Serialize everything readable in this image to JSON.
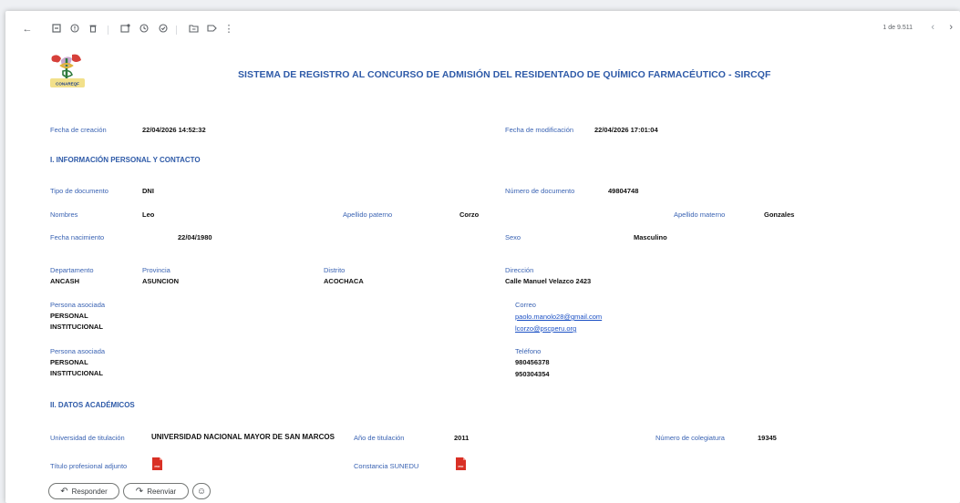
{
  "toolbar": {
    "icons": [
      "back-arrow-icon",
      "archive-icon",
      "report-spam-icon",
      "delete-icon",
      "mark-unread-icon",
      "snooze-icon",
      "add-task-icon",
      "move-to-icon",
      "label-icon",
      "more-icon"
    ],
    "pager_text": "1 de 9.511"
  },
  "email": {
    "title": "SISTEMA DE REGISTRO AL CONCURSO DE ADMISIÓN DEL RESIDENTADO DE QUÍMICO FARMACÉUTICO - SIRCQF",
    "logo_text": "CONAREQF",
    "fecha_creacion": {
      "label": "Fecha de creación",
      "value": "22/04/2026 14:52:32"
    },
    "fecha_modificacion": {
      "label": "Fecha de modificación",
      "value": "22/04/2026 17:01:04"
    },
    "section1": "I. INFORMACIÓN PERSONAL Y CONTACTO",
    "tipo_documento": {
      "label": "Tipo de documento",
      "value": "DNI"
    },
    "numero_documento": {
      "label": "Número de documento",
      "value": "49804748"
    },
    "nombres": {
      "label": "Nombres",
      "value": "Leo"
    },
    "apellido_paterno": {
      "label": "Apellido paterno",
      "value": "Corzo"
    },
    "apellido_materno": {
      "label": "Apellido materno",
      "value": "Gonzales"
    },
    "fecha_nacimiento": {
      "label": "Fecha nacimiento",
      "value": "22/04/1980"
    },
    "sexo": {
      "label": "Sexo",
      "value": "Masculino"
    },
    "departamento": {
      "label": "Departamento",
      "value": "ANCASH"
    },
    "provincia": {
      "label": "Provincia",
      "value": "ASUNCION"
    },
    "distrito": {
      "label": "Distrito",
      "value": "ACOCHACA"
    },
    "direccion": {
      "label": "Dirección",
      "value": "Calle Manuel Velazco 2423"
    },
    "persona_asociada_1": {
      "label": "Persona asociada",
      "line1": "PERSONAL",
      "line2": "INSTITUCIONAL"
    },
    "correo": {
      "label": "Correo",
      "email1": "paolo.manolo28@gmail.com",
      "email2": "lcorzo@pscperu.org"
    },
    "persona_asociada_2": {
      "label": "Persona asociada",
      "line1": "PERSONAL",
      "line2": "INSTITUCIONAL"
    },
    "telefono": {
      "label": "Teléfono",
      "phone1": "980456378",
      "phone2": "950304354"
    },
    "section2": "II. DATOS ACADÉMICOS",
    "universidad": {
      "label": "Universidad de titulación",
      "value": "UNIVERSIDAD NACIONAL MAYOR DE SAN MARCOS"
    },
    "anio_titulacion": {
      "label": "Año de titulación",
      "value": "2011"
    },
    "colegiatura": {
      "label": "Número de colegiatura",
      "value": "19345"
    },
    "titulo_adjunto": {
      "label": "Título profesional adjunto"
    },
    "constancia": {
      "label": "Constancia SUNEDU"
    }
  },
  "actions": {
    "reply_label": "Responder",
    "forward_label": "Reenviar"
  },
  "colors": {
    "label_blue": "#3a63b3",
    "title_blue": "#2e5aa8",
    "pdf_red": "#d93025"
  }
}
